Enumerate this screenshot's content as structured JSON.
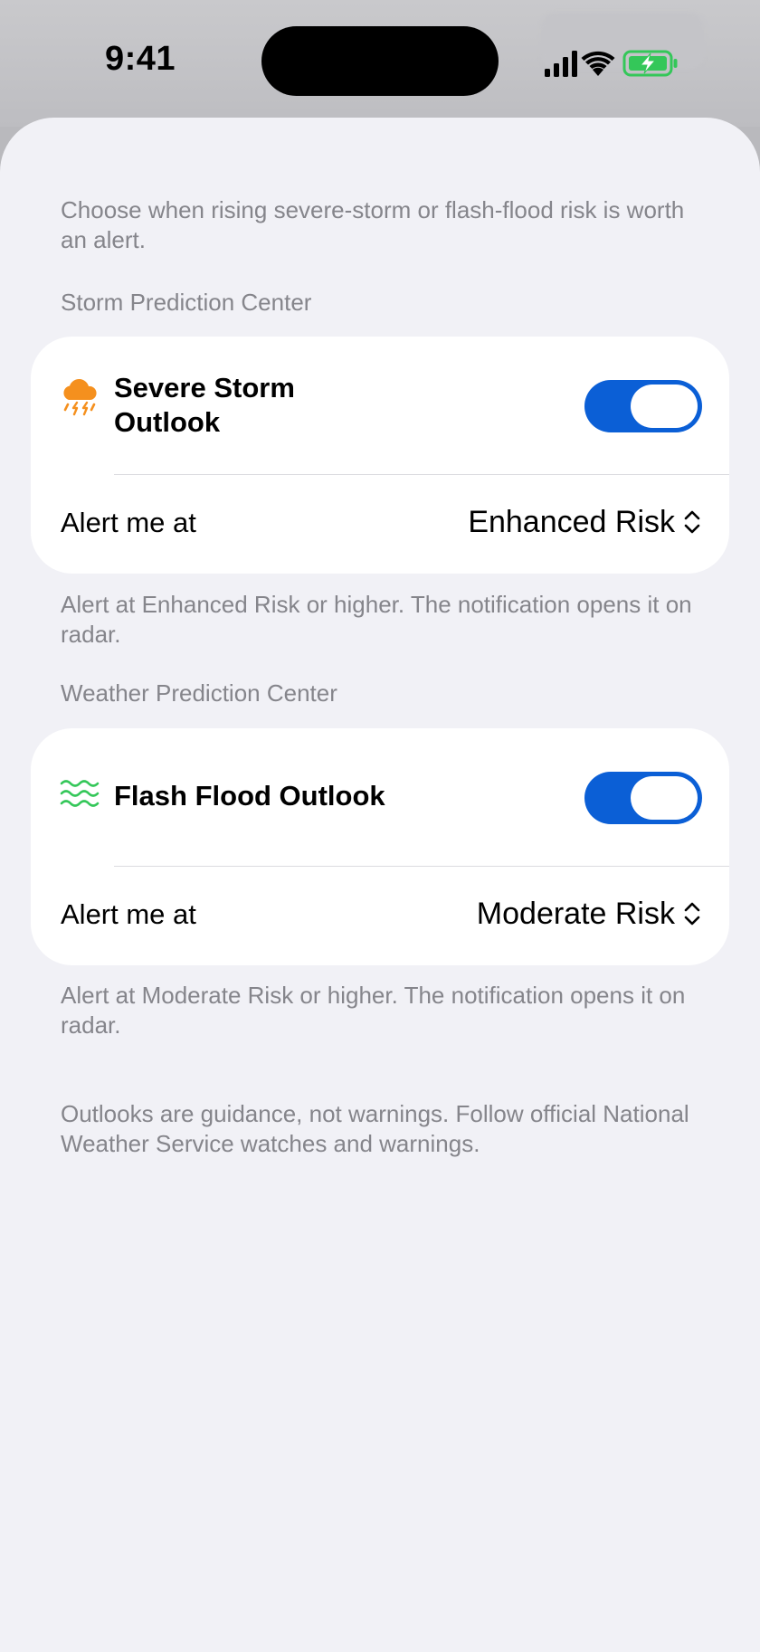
{
  "status_bar": {
    "time": "9:41"
  },
  "intro": "Choose when rising severe-storm or flash-flood risk is worth an alert.",
  "sections": [
    {
      "header": "Storm Prediction Center",
      "title": "Severe Storm Outlook",
      "icon": "cloud-bolt-rain-icon",
      "icon_color": "#f5901e",
      "enabled": true,
      "alert_label": "Alert me at",
      "alert_value": "Enhanced Risk",
      "footer": "Alert at Enhanced Risk or higher. The notification opens it on radar."
    },
    {
      "header": "Weather Prediction Center",
      "title": "Flash Flood Outlook",
      "icon": "water-waves-icon",
      "icon_color": "#34c759",
      "enabled": true,
      "alert_label": "Alert me at",
      "alert_value": "Moderate Risk",
      "footer": "Alert at Moderate Risk or higher. The notification opens it on radar."
    }
  ],
  "disclaimer": "Outlooks are guidance, not warnings. Follow official National Weather Service watches and warnings.",
  "colors": {
    "toggle_on": "#0b5fd6",
    "sheet_background": "#f1f1f6",
    "secondary_text": "#85858b",
    "battery_green": "#34c759"
  }
}
